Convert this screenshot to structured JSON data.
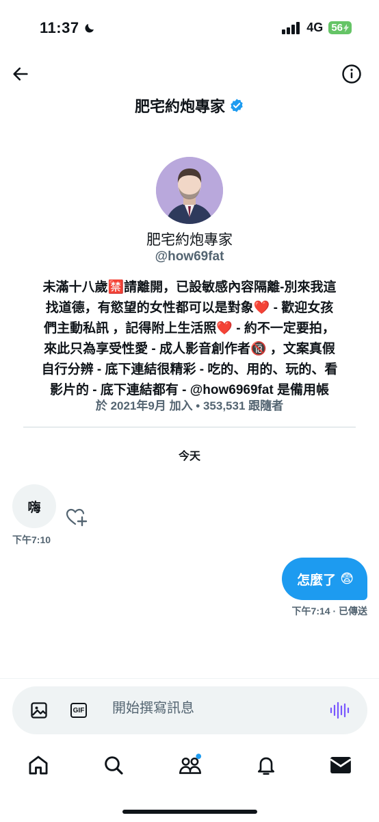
{
  "status_bar": {
    "time": "11:37",
    "network": "4G",
    "battery": "56"
  },
  "header": {
    "title": "肥宅約炮專家"
  },
  "profile": {
    "name": "肥宅約炮專家",
    "handle": "@how69fat",
    "bio_lines": [
      [
        "未滿十八歲",
        "🈲",
        "請離開，已設敏感內容隔離-別來我這"
      ],
      [
        "找道德，有慾望的女性都可以是對象",
        "❤️",
        " - 歡迎女孩"
      ],
      [
        "們主動私訊 ，記得附上生活照",
        "❤️",
        " - 約不一定要拍，"
      ],
      [
        "來此只為享受性愛 - 成人影音創作者",
        "🔞",
        " ，文案真假"
      ],
      [
        "自行分辨 - 底下連結很精彩 - 吃的、用的、玩的、看",
        "",
        ""
      ],
      [
        "影片的 - 底下連結都有 - @how6969fat 是備用帳",
        "",
        ""
      ]
    ],
    "meta": "於 2021年9月 加入 • 353,531 跟隨者"
  },
  "conversation": {
    "day_separator": "今天",
    "messages": [
      {
        "direction": "incoming",
        "text": "嗨",
        "emoji": "",
        "time": "下午7:10"
      },
      {
        "direction": "outgoing",
        "text": "怎麼了",
        "emoji": "😨",
        "time": "下午7:14 · 已傳送"
      }
    ]
  },
  "composer": {
    "placeholder": "開始撰寫訊息",
    "gif_label": "GIF"
  },
  "colors": {
    "accent": "#1d9bf0",
    "bubble_in": "#eff3f4",
    "battery": "#65c466",
    "voice": "#7856ff"
  },
  "icons": {
    "back": "arrow-left-icon",
    "info": "info-icon",
    "verified": "verified-badge-icon",
    "react": "heart-plus-icon",
    "image": "image-icon",
    "gif": "gif-icon",
    "voice": "voice-wave-icon",
    "nav": [
      "home-icon",
      "search-icon",
      "communities-icon",
      "notifications-icon",
      "messages-icon"
    ]
  }
}
